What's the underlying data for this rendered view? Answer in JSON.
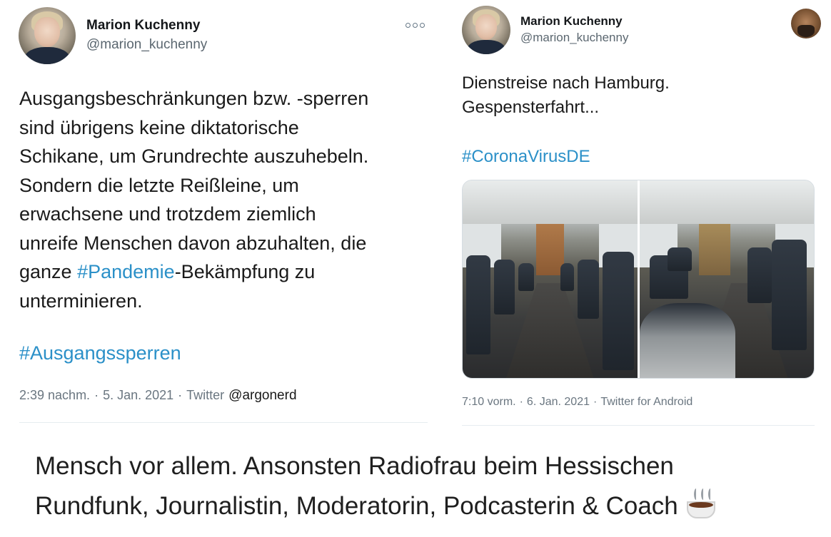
{
  "left_tweet": {
    "author_name": "Marion Kuchenny",
    "author_handle": "@marion_kuchenny",
    "more_icon": "more-options-icon",
    "text_lines": [
      {
        "text": "Ausgangsbeschränkungen bzw. -sperren"
      },
      {
        "text": "sind übrigens keine diktatorische"
      },
      {
        "text": "Schikane, um Grundrechte auszuhebeln."
      },
      {
        "text": "Sondern die letzte Reißleine, um"
      },
      {
        "text": "erwachsene und trotzdem ziemlich"
      },
      {
        "text": "unreife Menschen davon abzuhalten, die"
      },
      {
        "pre": "ganze ",
        "hashtag": "#Pandemie",
        "post": "-Bekämpfung zu"
      },
      {
        "text": "unterminieren."
      }
    ],
    "hashtag": "#Ausgangssperren",
    "time": "2:39 nachm.",
    "date": "5. Jan. 2021",
    "source": "Twitter",
    "watermark": "@argonerd"
  },
  "right_tweet": {
    "author_name": "Marion Kuchenny",
    "author_handle": "@marion_kuchenny",
    "text_line1": "Dienstreise nach Hamburg.",
    "text_line2": "Gespensterfahrt...",
    "hashtag": "#CoronaVirusDE",
    "time": "7:10 vorm.",
    "date": "6. Jan. 2021",
    "source": "Twitter for Android"
  },
  "bio": {
    "line1": "Mensch vor allem. Ansonsten Radiofrau beim Hessischen",
    "line2": "Rundfunk, Journalistin, Moderatorin, Podcasterin & Coach",
    "emoji_icon": "hot-beverage-icon"
  },
  "colors": {
    "hashtag": "#2b90c8",
    "meta_text": "#6a7680",
    "divider": "#e6ecf0"
  }
}
